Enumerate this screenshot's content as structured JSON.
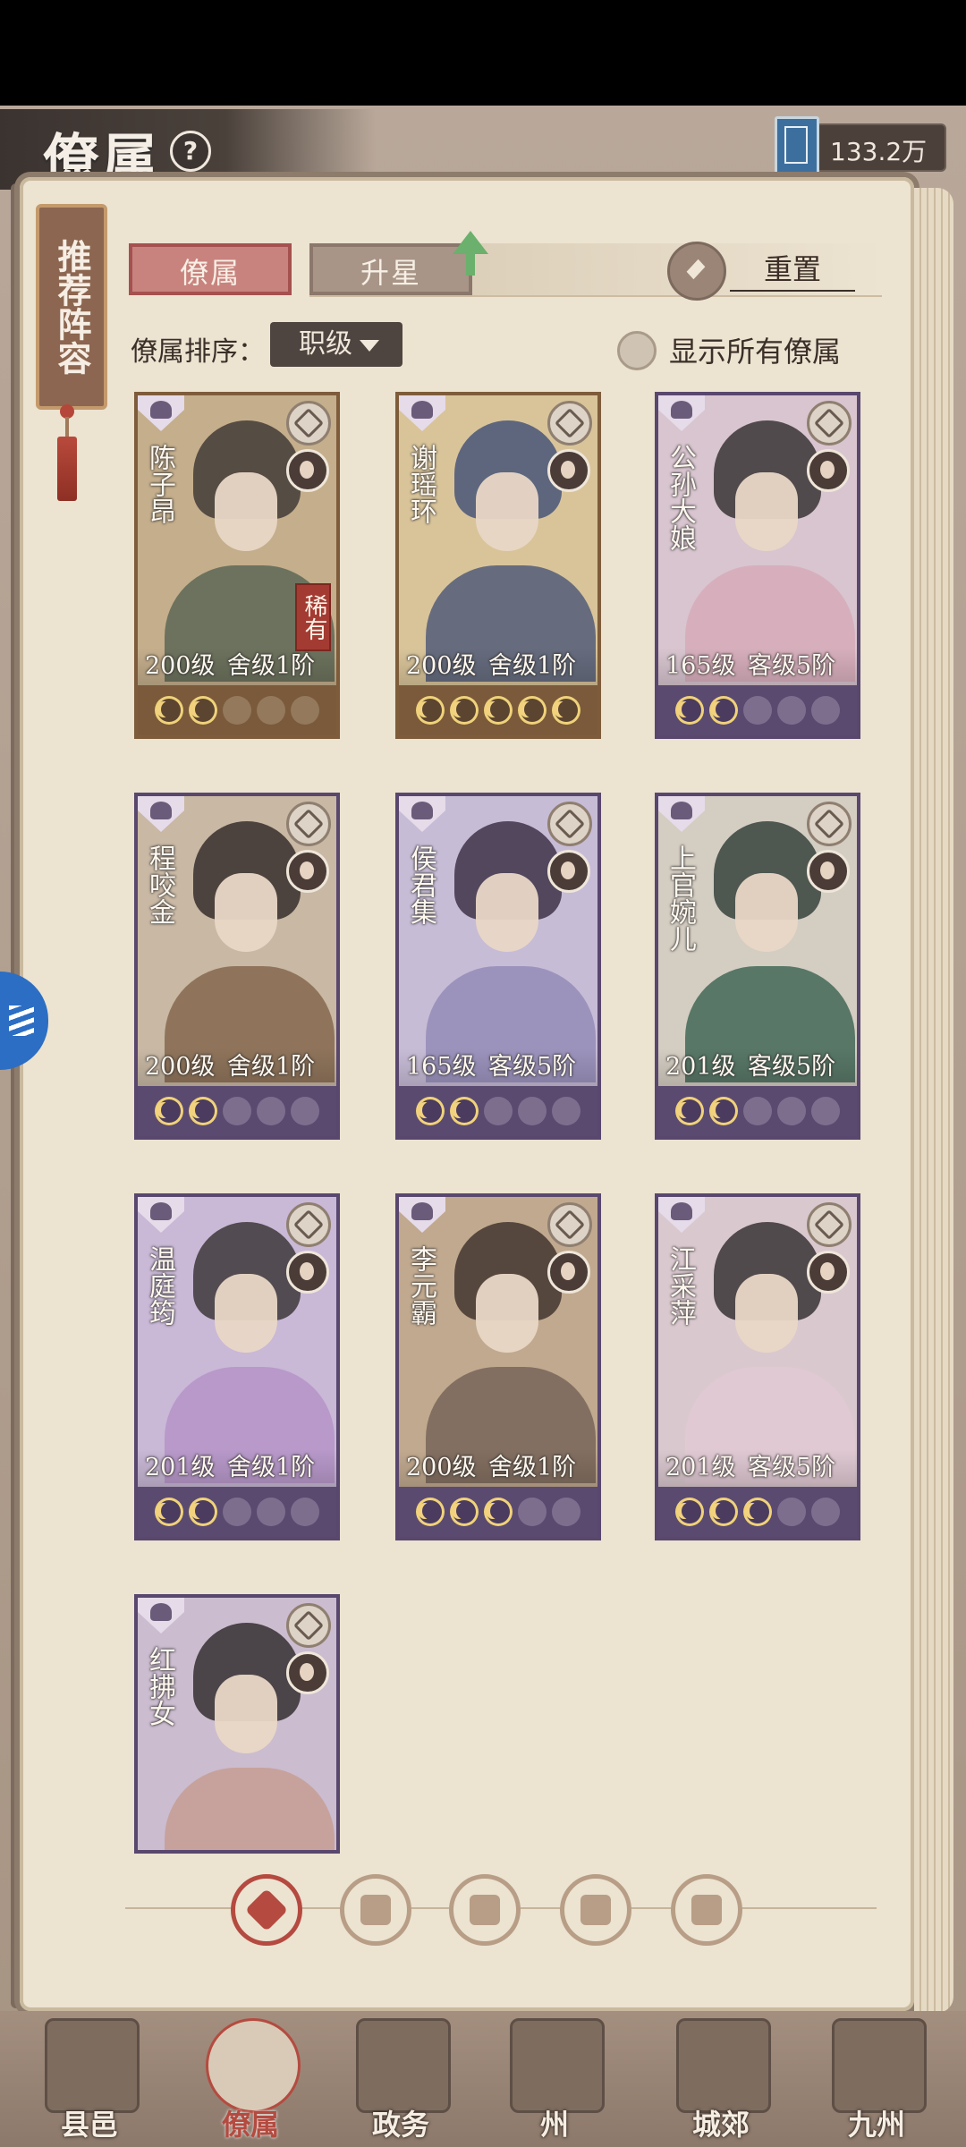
{
  "header": {
    "title": "僚属",
    "help": "?",
    "currency_value": "133.2万"
  },
  "recommend": {
    "label": "推荐阵容"
  },
  "tabs": {
    "active": "僚属",
    "inactive": "升星"
  },
  "reset": {
    "label": "重置"
  },
  "sort": {
    "label": "僚属排序：",
    "selected": "职级"
  },
  "show_all": {
    "label": "显示所有僚属"
  },
  "cards": [
    {
      "name": "陈子昂",
      "level": "200级",
      "rank": "舍级1阶",
      "rarity": "稀有",
      "stars": 2,
      "theme": "gold",
      "hair": "#3a3331",
      "body": "#4f5e4e",
      "bg": "#c4ae8c"
    },
    {
      "name": "谢瑶环",
      "level": "200级",
      "rank": "舍级1阶",
      "rarity": "",
      "stars": 5,
      "theme": "gold",
      "hair": "#3e4f77",
      "body": "#3f4f74",
      "bg": "#d9c49a"
    },
    {
      "name": "公孙大娘",
      "level": "165级",
      "rank": "客级5阶",
      "rarity": "",
      "stars": 2,
      "theme": "purple",
      "hair": "#2f2a2b",
      "body": "#d7a7b6",
      "bg": "#d8c5cf"
    },
    {
      "name": "程咬金",
      "level": "200级",
      "rank": "舍级1阶",
      "rarity": "",
      "stars": 2,
      "theme": "purple",
      "hair": "#2e2624",
      "body": "#7c5d43",
      "bg": "#c8b8a4"
    },
    {
      "name": "侯君集",
      "level": "165级",
      "rank": "客级5阶",
      "rarity": "",
      "stars": 2,
      "theme": "purple",
      "hair": "#35293f",
      "body": "#8e86b4",
      "bg": "#c7bcd6"
    },
    {
      "name": "上官婉儿",
      "level": "201级",
      "rank": "客级5阶",
      "rarity": "",
      "stars": 2,
      "theme": "purple",
      "hair": "#2c3a33",
      "body": "#2f5a48",
      "bg": "#d4cdc2"
    },
    {
      "name": "温庭筠",
      "level": "201级",
      "rank": "舍级1阶",
      "rarity": "",
      "stars": 2,
      "theme": "purple",
      "hair": "#34302f",
      "body": "#b18fc6",
      "bg": "#c9b8d6"
    },
    {
      "name": "李元霸",
      "level": "200级",
      "rank": "舍级1阶",
      "rarity": "",
      "stars": 3,
      "theme": "purple",
      "hair": "#3b2e29",
      "body": "#6d5c52",
      "bg": "#c1a98f"
    },
    {
      "name": "江采萍",
      "level": "201级",
      "rank": "客级5阶",
      "rarity": "",
      "stars": 3,
      "theme": "purple",
      "hair": "#2e2a2b",
      "body": "#e2c9d4",
      "bg": "#dac8cf"
    },
    {
      "name": "红拂女",
      "level": "",
      "rank": "",
      "rarity": "",
      "stars": 0,
      "theme": "purple",
      "hair": "#2a2526",
      "body": "#c59a8b",
      "bg": "#cbbccf"
    }
  ],
  "filters": [
    "all-icon",
    "hat-icon",
    "gourd-icon",
    "fan-icon",
    "qilin-icon"
  ],
  "nav": [
    {
      "label": "县邑"
    },
    {
      "label": "僚属"
    },
    {
      "label": "政务"
    },
    {
      "label": "州"
    },
    {
      "label": "城郊"
    },
    {
      "label": "九州"
    }
  ]
}
